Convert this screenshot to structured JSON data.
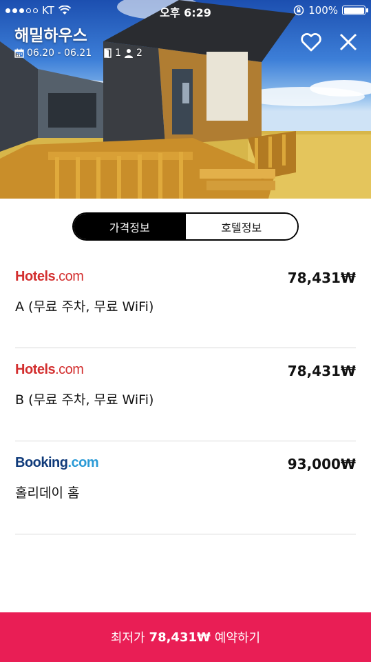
{
  "status_bar": {
    "carrier": "KT",
    "time": "오후 6:29",
    "battery": "100%"
  },
  "header": {
    "title": "해밀하우스",
    "dates": "06.20 - 06.21",
    "rooms": "1",
    "guests": "2"
  },
  "tabs": [
    {
      "label": "가격정보"
    },
    {
      "label": "호텔정보"
    }
  ],
  "offers": [
    {
      "provider_main": "Hotels",
      "provider_suffix": ".com",
      "price": "78,431₩",
      "room": "A (무료 주차, 무료 WiFi)"
    },
    {
      "provider_main": "Hotels",
      "provider_suffix": ".com",
      "price": "78,431₩",
      "room": "B (무료 주차, 무료 WiFi)"
    },
    {
      "provider_main": "Booking",
      "provider_suffix": ".com",
      "price": "93,000₩",
      "room": "홀리데이 홈"
    }
  ],
  "book_button": {
    "prefix": "최저가",
    "price": "78,431₩",
    "suffix": "예약하기"
  },
  "icons": [
    "wifi-icon",
    "lock-rotation-icon",
    "calendar-icon",
    "door-icon",
    "person-icon",
    "heart-icon",
    "close-icon"
  ],
  "colors": {
    "accent": "#e91e55",
    "hotels_red": "#d32f2f",
    "booking_dark": "#0f3a7a",
    "booking_light": "#2a9ad6"
  }
}
